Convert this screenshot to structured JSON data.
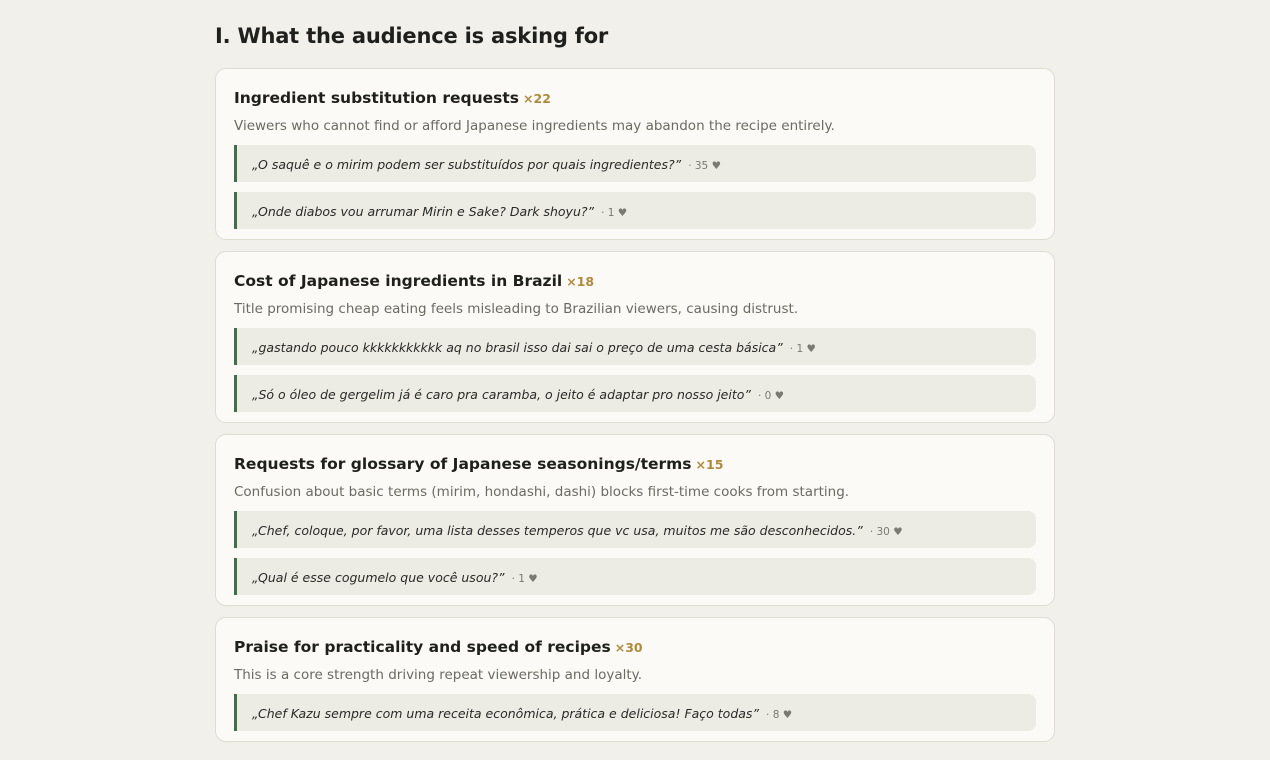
{
  "section": {
    "title": "I. What the audience is asking for"
  },
  "cards": [
    {
      "title": "Ingredient substitution requests",
      "count": "×22",
      "description": "Viewers who cannot find or afford Japanese ingredients may abandon the recipe entirely.",
      "quotes": [
        {
          "text": "„O saquê e o mirim podem ser substituídos por quais ingredientes?”",
          "likes": "· 35"
        },
        {
          "text": "„Onde diabos vou arrumar Mirin e Sake? Dark shoyu?”",
          "likes": "· 1"
        }
      ]
    },
    {
      "title": "Cost of Japanese ingredients in Brazil",
      "count": "×18",
      "description": "Title promising cheap eating feels misleading to Brazilian viewers, causing distrust.",
      "quotes": [
        {
          "text": "„gastando pouco kkkkkkkkkkk aq no brasil isso dai sai o preço de uma cesta básica”",
          "likes": "· 1"
        },
        {
          "text": "„Só o óleo de gergelim já é caro pra caramba, o jeito é adaptar pro nosso jeito”",
          "likes": "· 0"
        }
      ]
    },
    {
      "title": "Requests for glossary of Japanese seasonings/terms",
      "count": "×15",
      "description": "Confusion about basic terms (mirim, hondashi, dashi) blocks first-time cooks from starting.",
      "quotes": [
        {
          "text": "„Chef, coloque, por favor, uma lista desses temperos que vc usa, muitos me são desconhecidos.”",
          "likes": "· 30"
        },
        {
          "text": "„Qual é esse cogumelo que você usou?”",
          "likes": "· 1"
        }
      ]
    },
    {
      "title": "Praise for practicality and speed of recipes",
      "count": "×30",
      "description": "This is a core strength driving repeat viewership and loyalty.",
      "quotes": [
        {
          "text": "„Chef Kazu sempre com uma receita econômica, prática e deliciosa! Faço todas”",
          "likes": "· 8"
        }
      ]
    }
  ],
  "icons": {
    "heart": "heart-icon"
  },
  "colors": {
    "background": "#f1f0ea",
    "card": "#fbfaf6",
    "count": "#b08a3c",
    "quote_border": "#3f6e4b",
    "quote_bg": "#ecebe4"
  }
}
